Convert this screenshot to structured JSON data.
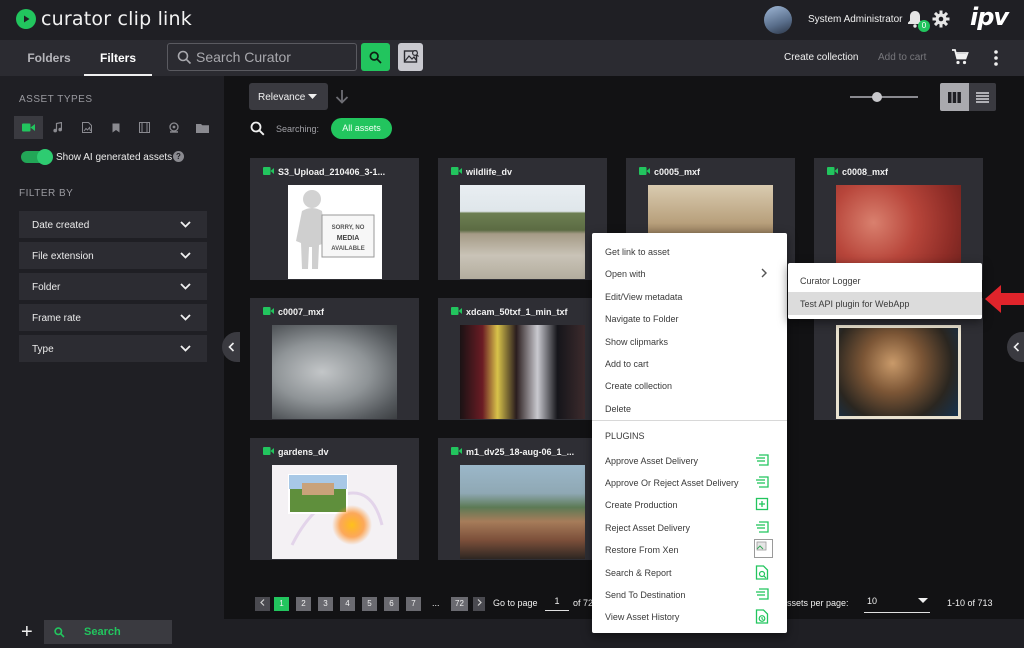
{
  "app": {
    "title": "curator clip link",
    "brand": "ipv"
  },
  "header": {
    "user_name": "System Administrator",
    "notification_count": "0"
  },
  "toolbar": {
    "tabs": [
      {
        "label": "Folders"
      },
      {
        "label": "Filters"
      }
    ],
    "search_placeholder": "Search Curator",
    "create_collection": "Create collection",
    "add_to_cart": "Add to cart"
  },
  "sidebar": {
    "asset_types_heading": "ASSET TYPES",
    "asset_type_icons": [
      "video-icon",
      "audio-icon",
      "image-icon",
      "bookmark-icon",
      "filmstrip-icon",
      "webcam-icon",
      "folder-icon"
    ],
    "show_ai_label": "Show AI generated assets",
    "show_ai_enabled": true,
    "filter_by_heading": "FILTER BY",
    "filters": [
      {
        "label": "Date created"
      },
      {
        "label": "File extension"
      },
      {
        "label": "Folder"
      },
      {
        "label": "Frame rate"
      },
      {
        "label": "Type"
      }
    ]
  },
  "results": {
    "sort_label": "Relevance",
    "searching_label": "Searching:",
    "searching_chip": "All assets",
    "assets": [
      {
        "title": "S3_Upload_210406_3-1..."
      },
      {
        "title": "wildlife_dv"
      },
      {
        "title": "c0005_mxf"
      },
      {
        "title": "c0008_mxf"
      },
      {
        "title": "c0007_mxf"
      },
      {
        "title": "xdcam_50txf_1_min_txf"
      },
      {
        "title": "gardens_dv"
      },
      {
        "title": "m1_dv25_18-aug-06_1_..."
      }
    ],
    "placeholder_thumb_text": [
      "SORRY, NO",
      "MEDIA",
      "AVAILABLE"
    ]
  },
  "pagination": {
    "pages": [
      "1",
      "2",
      "3",
      "4",
      "5",
      "6",
      "7",
      "...",
      "72"
    ],
    "current_page": "1",
    "go_to_label": "Go to page",
    "page_input": "1",
    "of_total": "of 72",
    "per_page_label": "ssets per page:",
    "per_page_value": "10",
    "range": "1-10 of 713"
  },
  "bottom": {
    "search_label": "Search"
  },
  "context_menu": {
    "items": [
      {
        "label": "Get link to asset"
      },
      {
        "label": "Open with"
      },
      {
        "label": "Edit/View metadata"
      },
      {
        "label": "Navigate to Folder"
      },
      {
        "label": "Show clipmarks"
      },
      {
        "label": "Add to cart"
      },
      {
        "label": "Create collection"
      },
      {
        "label": "Delete"
      }
    ],
    "plugins_heading": "PLUGINS",
    "plugins": [
      {
        "label": "Approve Asset Delivery",
        "icon": "delivery-icon"
      },
      {
        "label": "Approve Or Reject Asset Delivery",
        "icon": "delivery-icon"
      },
      {
        "label": "Create Production",
        "icon": "add-box-icon"
      },
      {
        "label": "Reject Asset Delivery",
        "icon": "delivery-icon"
      },
      {
        "label": "Restore From Xen",
        "icon": "broken-image-icon"
      },
      {
        "label": "Search & Report",
        "icon": "search-doc-icon"
      },
      {
        "label": "Send To Destination",
        "icon": "delivery-icon"
      },
      {
        "label": "View Asset History",
        "icon": "history-doc-icon"
      }
    ]
  },
  "submenu": {
    "items": [
      {
        "label": "Curator Logger"
      },
      {
        "label": "Test API plugin for WebApp",
        "highlighted": true
      }
    ]
  },
  "colors": {
    "accent": "#22c55e",
    "annotation_arrow": "#e0242b"
  }
}
